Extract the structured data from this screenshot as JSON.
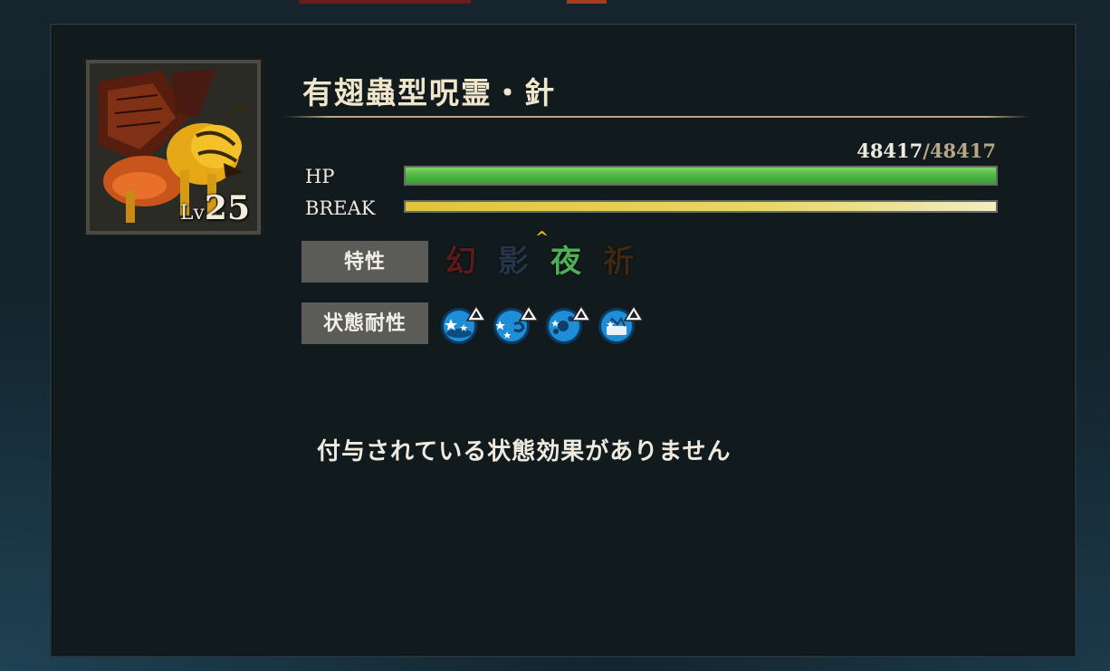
{
  "enemy": {
    "name": "有翅蟲型呪霊・針",
    "level_prefix": "Lv",
    "level": "25",
    "portrait": "wasp-curse-portrait"
  },
  "hp": {
    "label": "HP",
    "current": "48417",
    "separator": "/",
    "max": "48417",
    "fill": 1.0,
    "color": "#4bb544"
  },
  "break": {
    "label": "BREAK",
    "fill": 1.0,
    "color": "#e9d667"
  },
  "traits": {
    "label": "特性",
    "items": [
      {
        "glyph": "幻",
        "color": "#5c1a18",
        "icon": "phantom-trait-icon"
      },
      {
        "glyph": "影",
        "color": "#27354a",
        "icon": "shadow-trait-icon"
      },
      {
        "glyph": "夜",
        "color": "#4fae56",
        "icon": "night-trait-icon",
        "boosted": true,
        "boost_glyph": "^"
      },
      {
        "glyph": "祈",
        "color": "#3e2a14",
        "icon": "prayer-trait-icon"
      }
    ]
  },
  "resistances": {
    "label": "状態耐性",
    "items": [
      {
        "icon": "stun-resist-icon"
      },
      {
        "icon": "dizzy-resist-icon"
      },
      {
        "icon": "poison-resist-icon"
      },
      {
        "icon": "seal-resist-icon"
      }
    ]
  },
  "status_effects": {
    "empty_message": "付与されている状態効果がありません"
  }
}
